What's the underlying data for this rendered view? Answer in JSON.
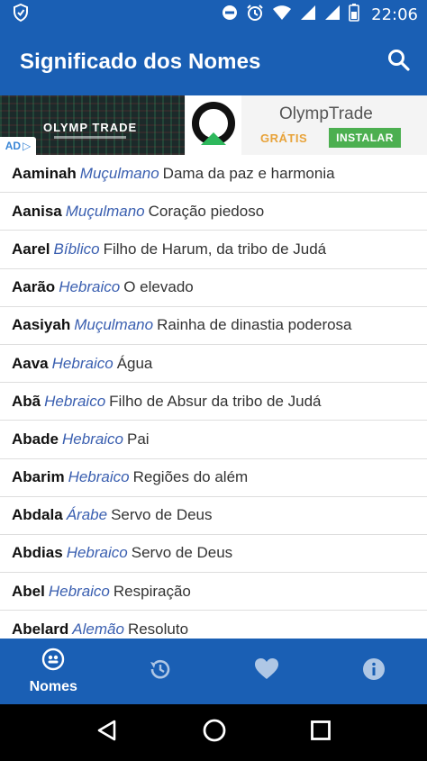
{
  "statusbar": {
    "time": "22:06",
    "icons": [
      "app-shield-icon",
      "do-not-disturb-icon",
      "alarm-icon",
      "wifi-icon",
      "signal-icon",
      "signal-icon-2",
      "battery-icon"
    ]
  },
  "appbar": {
    "title": "Significado dos Nomes",
    "search_icon": "search-icon"
  },
  "ad": {
    "brand_banner": "OLYMP TRADE",
    "title": "OlympTrade",
    "free_label": "GRÁTIS",
    "install_label": "INSTALAR",
    "adchoices_label": "▷"
  },
  "names": [
    {
      "name": "Aaminah",
      "origin": "Muçulmano",
      "meaning": "Dama da paz e harmonia"
    },
    {
      "name": "Aanisa",
      "origin": "Muçulmano",
      "meaning": "Coração piedoso"
    },
    {
      "name": "Aarel",
      "origin": "Bíblico",
      "meaning": "Filho de Harum, da tribo de Judá"
    },
    {
      "name": "Aarão",
      "origin": "Hebraico",
      "meaning": "O elevado"
    },
    {
      "name": "Aasiyah",
      "origin": "Muçulmano",
      "meaning": "Rainha de dinastia poderosa"
    },
    {
      "name": "Aava",
      "origin": "Hebraico",
      "meaning": "Água"
    },
    {
      "name": "Abã",
      "origin": "Hebraico",
      "meaning": "Filho de Absur da tribo de Judá"
    },
    {
      "name": "Abade",
      "origin": "Hebraico",
      "meaning": "Pai"
    },
    {
      "name": "Abarim",
      "origin": "Hebraico",
      "meaning": "Regiões do além"
    },
    {
      "name": "Abdala",
      "origin": "Árabe",
      "meaning": "Servo de Deus"
    },
    {
      "name": "Abdias",
      "origin": "Hebraico",
      "meaning": "Servo de Deus"
    },
    {
      "name": "Abel",
      "origin": "Hebraico",
      "meaning": "Respiração"
    },
    {
      "name": "Abelard",
      "origin": "Alemão",
      "meaning": "Resoluto"
    }
  ],
  "bottomnav": {
    "tabs": [
      {
        "label": "Nomes",
        "icon": "names-icon",
        "active": true
      },
      {
        "label": "",
        "icon": "history-icon",
        "active": false
      },
      {
        "label": "",
        "icon": "heart-icon",
        "active": false
      },
      {
        "label": "",
        "icon": "info-icon",
        "active": false
      }
    ]
  },
  "colors": {
    "primary": "#1a5fb4",
    "origin_text": "#3a5fb0",
    "install_green": "#4caf50",
    "free_orange": "#e8a33a"
  }
}
